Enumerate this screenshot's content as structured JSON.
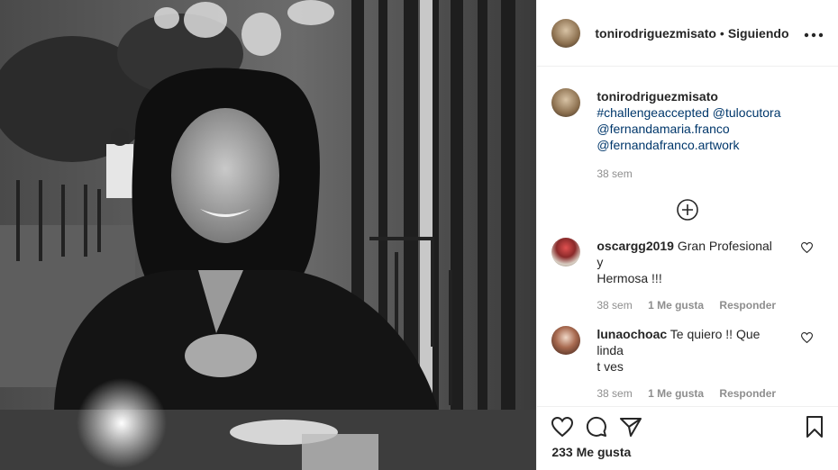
{
  "post": {
    "username": "tonirodriguezmisato",
    "separator": "•",
    "follow_state": "Siguiendo",
    "more_icon": "more-icon",
    "caption": {
      "username": "tonirodriguezmisato",
      "line1_hashtag": "#challengeaccepted",
      "line1_mention": "@tulocutora",
      "line2_mention": "@fernandamaria.franco",
      "line3_mention": "@fernandafranco.artwork",
      "time": "38 sem"
    },
    "comments": [
      {
        "username": "oscargg2019",
        "text_line1": "Gran Profesional y",
        "text_line2": "Hermosa !!!",
        "time": "38 sem",
        "likes": "1 Me gusta",
        "reply": "Responder"
      },
      {
        "username": "lunaochoac",
        "text_line1": "Te quiero !! Que linda",
        "text_line2": "t ves",
        "time": "38 sem",
        "likes": "1 Me gusta",
        "reply": "Responder"
      }
    ],
    "likes_count": "233 Me gusta",
    "icons": [
      "heart-icon",
      "comment-icon",
      "share-icon",
      "bookmark-icon",
      "plus-circle-icon"
    ],
    "colors": {
      "link": "#00376b",
      "muted": "#8e8e8e",
      "text": "#262626",
      "border": "#efefef"
    }
  }
}
